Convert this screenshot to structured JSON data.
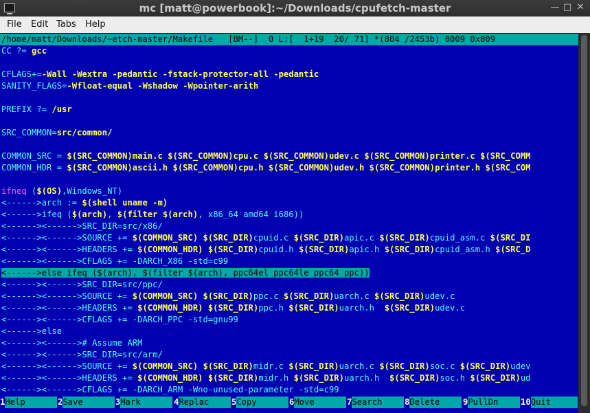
{
  "window": {
    "title": "mc [matt@powerbook]:~/Downloads/cpufetch-master"
  },
  "menu": {
    "file": "File",
    "edit": "Edit",
    "tabs": "Tabs",
    "help": "Help"
  },
  "status_line": "/home/matt/Downloads/~etch-master/Makefile   [BM--]  0 L:[  1+19  20/ 71] *(804 /2453b) 0009 0x009",
  "editor_lines": [
    [
      [
        "CC ?= ",
        "c"
      ],
      [
        "gcc",
        "y"
      ]
    ],
    [],
    [
      [
        "CFLAGS+=",
        "c"
      ],
      [
        "-Wall -Wextra -pedantic -fstack-protector-all -pedantic",
        "y"
      ]
    ],
    [
      [
        "SANITY_FLAGS=",
        "c"
      ],
      [
        "-Wfloat-equal -Wshadow -Wpointer-arith",
        "y"
      ]
    ],
    [],
    [
      [
        "PREFIX ?= ",
        "c"
      ],
      [
        "/usr",
        "y"
      ]
    ],
    [],
    [
      [
        "SRC_COMMON=",
        "c"
      ],
      [
        "src/common/",
        "y"
      ]
    ],
    [],
    [
      [
        "COMMON_SRC = ",
        "c"
      ],
      [
        "$(SRC_COMMON)",
        "y"
      ],
      [
        "main.c ",
        "y"
      ],
      [
        "$(SRC_COMMON)",
        "y"
      ],
      [
        "cpu.c ",
        "y"
      ],
      [
        "$(SRC_COMMON)",
        "y"
      ],
      [
        "udev.c ",
        "y"
      ],
      [
        "$(SRC_COMMON)",
        "y"
      ],
      [
        "printer.c ",
        "y"
      ],
      [
        "$(SRC_COMM",
        "y"
      ]
    ],
    [
      [
        "COMMON_HDR = ",
        "c"
      ],
      [
        "$(SRC_COMMON)",
        "y"
      ],
      [
        "ascii.h ",
        "y"
      ],
      [
        "$(SRC_COMMON)",
        "y"
      ],
      [
        "cpu.h ",
        "y"
      ],
      [
        "$(SRC_COMMON)",
        "y"
      ],
      [
        "udev.h ",
        "y"
      ],
      [
        "$(SRC_COMMON)",
        "y"
      ],
      [
        "printer.h ",
        "y"
      ],
      [
        "$(SRC_COM",
        "y"
      ]
    ],
    [],
    [
      [
        "ifneq ",
        "m"
      ],
      [
        "(",
        "c"
      ],
      [
        "$(OS)",
        "y"
      ],
      [
        ",Windows_NT)",
        "c"
      ]
    ],
    [
      [
        "<------>",
        "c"
      ],
      [
        "arch := ",
        "c"
      ],
      [
        "$(shell uname -m)",
        "y"
      ]
    ],
    [
      [
        "<------>",
        "c"
      ],
      [
        "ifeq (",
        "c"
      ],
      [
        "$(arch)",
        "y"
      ],
      [
        ", ",
        "c"
      ],
      [
        "$(filter $(arch)",
        "y"
      ],
      [
        ", x86_64 amd64 i686))",
        "c"
      ]
    ],
    [
      [
        "<------><------>",
        "c"
      ],
      [
        "SRC_DIR=src/x86/",
        "c"
      ]
    ],
    [
      [
        "<------><------>",
        "c"
      ],
      [
        "SOURCE += ",
        "c"
      ],
      [
        "$(COMMON_SRC) $(SRC_DIR)",
        "y"
      ],
      [
        "cpuid.c ",
        "c"
      ],
      [
        "$(SRC_DIR)",
        "y"
      ],
      [
        "apic.c ",
        "c"
      ],
      [
        "$(SRC_DIR)",
        "y"
      ],
      [
        "cpuid_asm.c ",
        "c"
      ],
      [
        "$(SRC_DI",
        "y"
      ]
    ],
    [
      [
        "<------><------>",
        "c"
      ],
      [
        "HEADERS += ",
        "c"
      ],
      [
        "$(COMMON_HDR) $(SRC_DIR)",
        "y"
      ],
      [
        "cpuid.h ",
        "c"
      ],
      [
        "$(SRC_DIR)",
        "y"
      ],
      [
        "apic.h ",
        "c"
      ],
      [
        "$(SRC_DIR)",
        "y"
      ],
      [
        "cpuid_asm.h ",
        "c"
      ],
      [
        "$(SRC_D",
        "y"
      ]
    ],
    [
      [
        "<------><------>",
        "c"
      ],
      [
        "CFLAGS += -DARCH_X86 -std=c99",
        "c"
      ]
    ],
    [
      [
        "<------>else ifeq ($(arch), $(filter $(arch), ppc64el ppc64le ppc64 ppc))",
        "hl"
      ]
    ],
    [
      [
        "<------><------>",
        "c"
      ],
      [
        "SRC_DIR=src/ppc/",
        "c"
      ]
    ],
    [
      [
        "<------><------>",
        "c"
      ],
      [
        "SOURCE += ",
        "c"
      ],
      [
        "$(COMMON_SRC) $(SRC_DIR)",
        "y"
      ],
      [
        "ppc.c ",
        "c"
      ],
      [
        "$(SRC_DIR)",
        "y"
      ],
      [
        "uarch.c ",
        "c"
      ],
      [
        "$(SRC_DIR)",
        "y"
      ],
      [
        "udev.c",
        "c"
      ]
    ],
    [
      [
        "<------><------>",
        "c"
      ],
      [
        "HEADERS += ",
        "c"
      ],
      [
        "$(COMMON_HDR) $(SRC_DIR)",
        "y"
      ],
      [
        "ppc.h ",
        "c"
      ],
      [
        "$(SRC_DIR)",
        "y"
      ],
      [
        "uarch.h  ",
        "c"
      ],
      [
        "$(SRC_DIR)",
        "y"
      ],
      [
        "udev.c",
        "c"
      ]
    ],
    [
      [
        "<------><------>",
        "c"
      ],
      [
        "CFLAGS += -DARCH_PPC -std=gnu99",
        "c"
      ]
    ],
    [
      [
        "<------>",
        "c"
      ],
      [
        "else",
        "c"
      ]
    ],
    [
      [
        "<------><------>",
        "c"
      ],
      [
        "# Assume ARM",
        "c"
      ]
    ],
    [
      [
        "<------><------>",
        "c"
      ],
      [
        "SRC_DIR=src/arm/",
        "c"
      ]
    ],
    [
      [
        "<------><------>",
        "c"
      ],
      [
        "SOURCE += ",
        "c"
      ],
      [
        "$(COMMON_SRC) $(SRC_DIR)",
        "y"
      ],
      [
        "midr.c ",
        "c"
      ],
      [
        "$(SRC_DIR)",
        "y"
      ],
      [
        "uarch.c ",
        "c"
      ],
      [
        "$(SRC_DIR)",
        "y"
      ],
      [
        "soc.c ",
        "c"
      ],
      [
        "$(SRC_DIR)",
        "y"
      ],
      [
        "udev",
        "c"
      ]
    ],
    [
      [
        "<------><------>",
        "c"
      ],
      [
        "HEADERS += ",
        "c"
      ],
      [
        "$(COMMON_HDR) $(SRC_DIR)",
        "y"
      ],
      [
        "midr.h ",
        "c"
      ],
      [
        "$(SRC_DIR)",
        "y"
      ],
      [
        "uarch.h  ",
        "c"
      ],
      [
        "$(SRC_DIR)",
        "y"
      ],
      [
        "soc.h ",
        "c"
      ],
      [
        "$(SRC_DIR)",
        "y"
      ],
      [
        "ud",
        "c"
      ]
    ],
    [
      [
        "<------><------>",
        "c"
      ],
      [
        "CFLAGS += -DARCH_ARM -Wno-unused-parameter -std=c99",
        "c"
      ]
    ]
  ],
  "function_keys": [
    {
      "num": "1",
      "label": "Help"
    },
    {
      "num": "2",
      "label": "Save"
    },
    {
      "num": "3",
      "label": "Mark"
    },
    {
      "num": "4",
      "label": "Replac"
    },
    {
      "num": "5",
      "label": "Copy"
    },
    {
      "num": "6",
      "label": "Move"
    },
    {
      "num": "7",
      "label": "Search"
    },
    {
      "num": "8",
      "label": "Delete"
    },
    {
      "num": "9",
      "label": "PullDn"
    },
    {
      "num": "10",
      "label": "Quit"
    }
  ],
  "colors": {
    "editor_bg": "#0000b0",
    "highlight": "#00a8a8",
    "keyword": "#ffff55",
    "text": "#55ffff"
  }
}
